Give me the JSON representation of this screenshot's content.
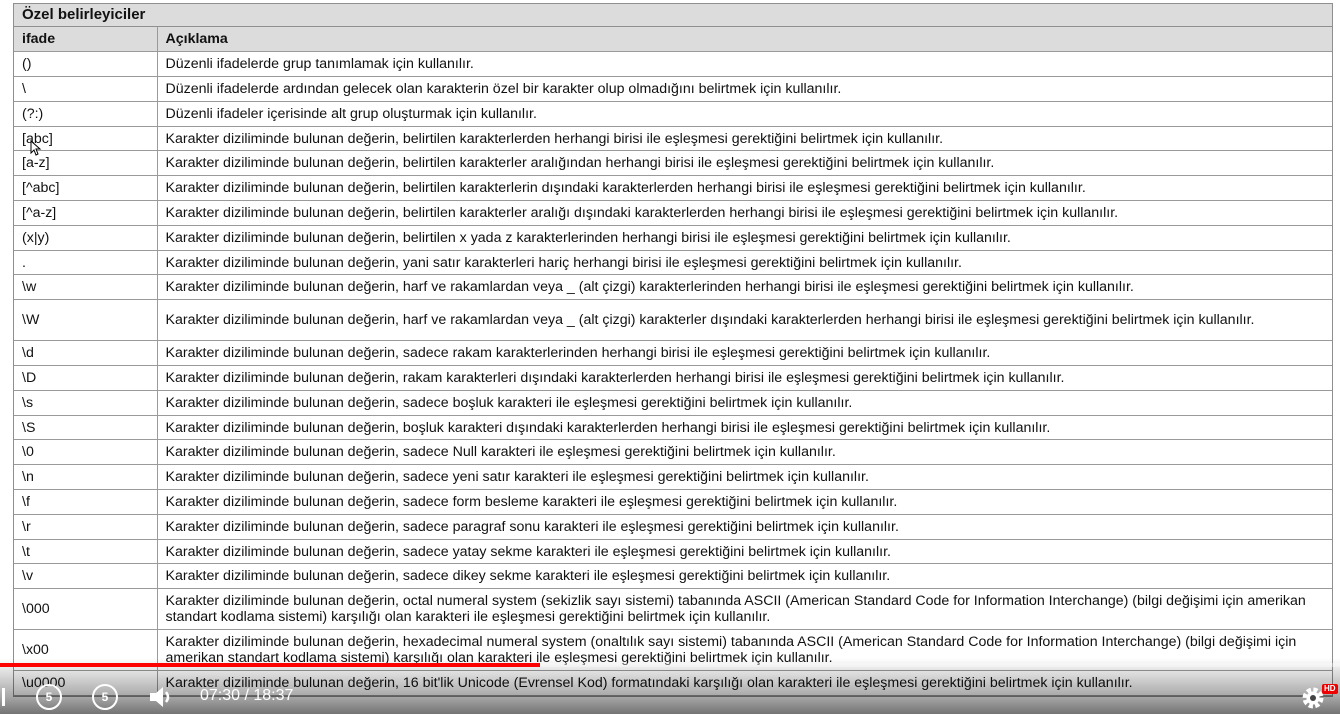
{
  "table": {
    "title": "Özel belirleyiciler",
    "headers": [
      "ifade",
      "Açıklama"
    ],
    "rows": [
      {
        "expr": "()",
        "desc": "Düzenli ifadelerde grup tanımlamak için kullanılır."
      },
      {
        "expr": "\\",
        "desc": "Düzenli ifadelerde ardından gelecek olan karakterin özel bir karakter olup olmadığını belirtmek için kullanılır."
      },
      {
        "expr": "(?:)",
        "desc": "Düzenli ifadeler içerisinde alt grup oluşturmak için kullanılır."
      },
      {
        "expr": "[abc]",
        "desc": "Karakter diziliminde bulunan değerin, belirtilen karakterlerden herhangi birisi ile eşleşmesi gerektiğini belirtmek için kullanılır."
      },
      {
        "expr": "[a-z]",
        "desc": "Karakter diziliminde bulunan değerin, belirtilen karakterler aralığından herhangi birisi ile eşleşmesi gerektiğini belirtmek için kullanılır."
      },
      {
        "expr": "[^abc]",
        "desc": "Karakter diziliminde bulunan değerin, belirtilen karakterlerin dışındaki karakterlerden herhangi birisi ile eşleşmesi gerektiğini belirtmek için kullanılır."
      },
      {
        "expr": "[^a-z]",
        "desc": "Karakter diziliminde bulunan değerin, belirtilen karakterler aralığı dışındaki karakterlerden herhangi birisi ile eşleşmesi gerektiğini belirtmek için kullanılır."
      },
      {
        "expr": "(x|y)",
        "desc": "Karakter diziliminde bulunan değerin, belirtilen x yada z karakterlerinden herhangi birisi ile eşleşmesi gerektiğini belirtmek için kullanılır."
      },
      {
        "expr": ".",
        "desc": "Karakter diziliminde bulunan değerin, yani satır karakterleri hariç herhangi birisi ile eşleşmesi gerektiğini belirtmek için kullanılır."
      },
      {
        "expr": "\\w",
        "desc": "Karakter diziliminde bulunan değerin, harf ve rakamlardan veya _ (alt çizgi) karakterlerinden herhangi birisi ile eşleşmesi gerektiğini belirtmek için kullanılır."
      },
      {
        "expr": "\\W",
        "desc": "Karakter diziliminde bulunan değerin, harf ve rakamlardan veya _ (alt çizgi) karakterler dışındaki karakterlerden herhangi birisi ile eşleşmesi gerektiğini belirtmek için kullanılır."
      },
      {
        "expr": "\\d",
        "desc": "Karakter diziliminde bulunan değerin, sadece rakam karakterlerinden herhangi birisi ile eşleşmesi gerektiğini belirtmek için kullanılır."
      },
      {
        "expr": "\\D",
        "desc": "Karakter diziliminde bulunan değerin, rakam karakterleri dışındaki karakterlerden herhangi birisi ile eşleşmesi gerektiğini belirtmek için kullanılır."
      },
      {
        "expr": "\\s",
        "desc": "Karakter diziliminde bulunan değerin, sadece boşluk karakteri ile eşleşmesi gerektiğini belirtmek için kullanılır."
      },
      {
        "expr": "\\S",
        "desc": "Karakter diziliminde bulunan değerin, boşluk karakteri dışındaki karakterlerden herhangi birisi ile eşleşmesi gerektiğini belirtmek için kullanılır."
      },
      {
        "expr": "\\0",
        "desc": "Karakter diziliminde bulunan değerin, sadece Null karakteri ile eşleşmesi gerektiğini belirtmek için kullanılır."
      },
      {
        "expr": "\\n",
        "desc": "Karakter diziliminde bulunan değerin, sadece yeni satır karakteri ile eşleşmesi gerektiğini belirtmek için kullanılır."
      },
      {
        "expr": "\\f",
        "desc": "Karakter diziliminde bulunan değerin, sadece form besleme karakteri ile eşleşmesi gerektiğini belirtmek için kullanılır."
      },
      {
        "expr": "\\r",
        "desc": "Karakter diziliminde bulunan değerin, sadece paragraf sonu karakteri ile eşleşmesi gerektiğini belirtmek için kullanılır."
      },
      {
        "expr": "\\t",
        "desc": "Karakter diziliminde bulunan değerin, sadece yatay sekme karakteri ile eşleşmesi gerektiğini belirtmek için kullanılır."
      },
      {
        "expr": "\\v",
        "desc": "Karakter diziliminde bulunan değerin, sadece dikey sekme karakteri ile eşleşmesi gerektiğini belirtmek için kullanılır."
      },
      {
        "expr": "\\000",
        "desc": "Karakter diziliminde bulunan değerin, octal numeral system (sekizlik sayı sistemi) tabanında ASCII (American Standard Code for Information Interchange) (bilgi değişimi için amerikan standart kodlama sistemi) karşılığı olan karakteri ile eşleşmesi gerektiğini belirtmek için kullanılır."
      },
      {
        "expr": "\\x00",
        "desc": "Karakter diziliminde bulunan değerin, hexadecimal numeral system (onaltılık sayı sistemi) tabanında ASCII (American Standard Code for Information Interchange) (bilgi değişimi için amerikan standart kodlama sistemi) karşılığı olan karakteri ile eşleşmesi gerektiğini belirtmek için kullanılır."
      },
      {
        "expr": "\\u0000",
        "desc": "Karakter diziliminde bulunan değerin, 16 bit'lik Unicode (Evrensel Kod) formatındaki karşılığı olan karakteri ile eşleşmesi gerektiğini belirtmek için kullanılır."
      }
    ]
  },
  "player": {
    "time_display": "07:30 / 18:37",
    "progress": 0.403,
    "rewind_seconds": "5",
    "forward_seconds": "5",
    "quality_badge": "HD",
    "accent_color": "#ff0000"
  }
}
